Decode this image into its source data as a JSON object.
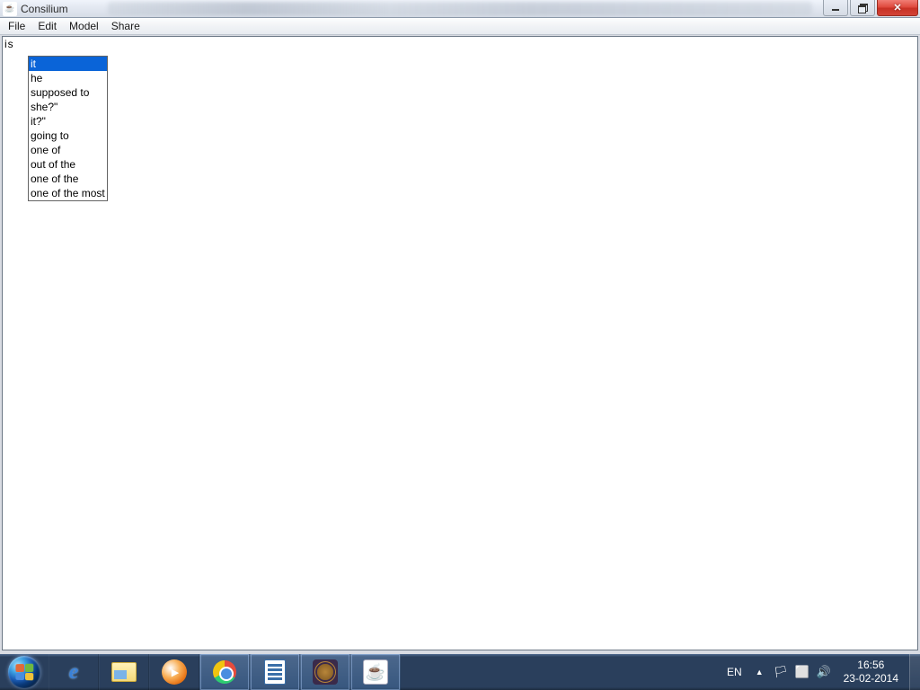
{
  "window": {
    "title": "Consilium"
  },
  "menubar": {
    "items": [
      "File",
      "Edit",
      "Model",
      "Share"
    ]
  },
  "editor": {
    "typed": "is"
  },
  "autocomplete": {
    "items": [
      {
        "label": "it",
        "selected": true
      },
      {
        "label": "he",
        "selected": false
      },
      {
        "label": "supposed to",
        "selected": false
      },
      {
        "label": "she?\"",
        "selected": false
      },
      {
        "label": "it?\"",
        "selected": false
      },
      {
        "label": "going to",
        "selected": false
      },
      {
        "label": "one of",
        "selected": false
      },
      {
        "label": "out of the",
        "selected": false
      },
      {
        "label": "one of the",
        "selected": false
      },
      {
        "label": "one of the most",
        "selected": false
      }
    ]
  },
  "taskbar": {
    "pinned": [
      {
        "name": "internet-explorer",
        "active": false
      },
      {
        "name": "file-explorer",
        "active": false
      },
      {
        "name": "windows-media-player",
        "active": false
      },
      {
        "name": "chrome",
        "active": true
      },
      {
        "name": "libreoffice-writer",
        "active": true
      },
      {
        "name": "eclipse-ee",
        "active": true
      },
      {
        "name": "java-app",
        "active": true
      }
    ]
  },
  "systray": {
    "lang": "EN",
    "time": "16:56",
    "date": "23-02-2014"
  }
}
